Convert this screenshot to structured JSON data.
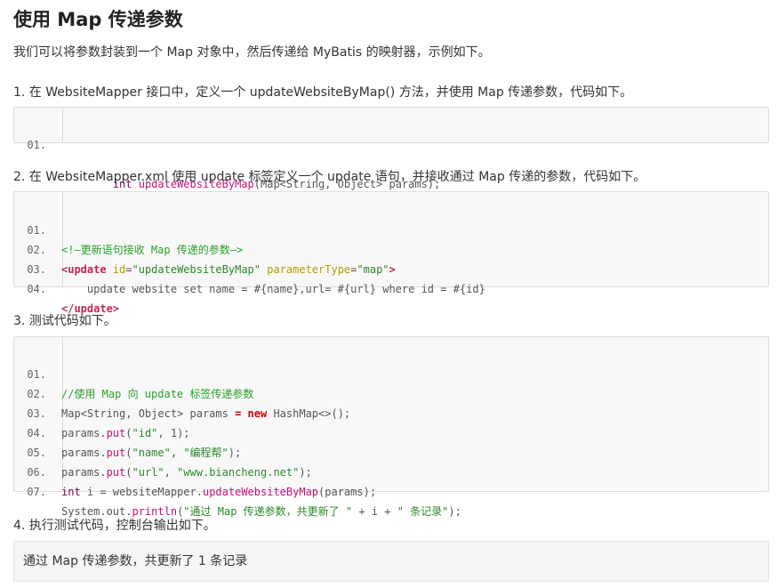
{
  "title": "使用 Map 传递参数",
  "intro": "我们可以将参数封装到一个 Map 对象中，然后传递给 MyBatis 的映射器，示例如下。",
  "steps": [
    {
      "text": "1. 在 WebsiteMapper 接口中，定义一个 updateWebsiteByMap() 方法，并使用 Map 传递参数，代码如下。"
    },
    {
      "text": "2. 在 WebsiteMapper.xml 使用 update 标签定义一个 update 语句，并接收通过 Map 传递的参数，代码如下。"
    },
    {
      "text": "3. 测试代码如下。"
    },
    {
      "text": "4. 执行测试代码，控制台输出如下。"
    }
  ],
  "code1": {
    "line_numbers": [
      "01."
    ],
    "lines": [
      [
        "int",
        " ",
        "updateWebsiteByMap",
        "(Map<String, Object> params);"
      ]
    ]
  },
  "code2": {
    "line_numbers": [
      "01.",
      "02.",
      "03.",
      "04."
    ],
    "l1": "<!—更新语句接收 Map 传递的参数—>",
    "l2_tag": "<update",
    "l2_sp1": " ",
    "l2_attr1": "id",
    "l2_eq1": "=",
    "l2_val1": "\"updateWebsiteByMap\"",
    "l2_sp2": " ",
    "l2_attr2": "parameterType",
    "l2_eq2": "=",
    "l2_val2": "\"map\"",
    "l2_close": ">",
    "l3": "    update website set name = #{name},url= #{url} where id = #{id}",
    "l4": "</update>"
  },
  "code3": {
    "line_numbers": [
      "01.",
      "02.",
      "03.",
      "04.",
      "05.",
      "06.",
      "07."
    ],
    "l1": "//使用 Map 向 update 标签传递参数",
    "l2a": "Map<String, Object> params ",
    "l2b": "=",
    "l2c": " ",
    "l2d": "new",
    "l2e": " HashMap<>();",
    "l3a": "params.",
    "l3b": "put",
    "l3c": "(",
    "l3d": "\"id\"",
    "l3e": ", 1);",
    "l4a": "params.",
    "l4b": "put",
    "l4c": "(",
    "l4d": "\"name\"",
    "l4e": ", ",
    "l4f": "\"编程帮\"",
    "l4g": ");",
    "l5a": "params.",
    "l5b": "put",
    "l5c": "(",
    "l5d": "\"url\"",
    "l5e": ", ",
    "l5f": "\"www.biancheng.net\"",
    "l5g": ");",
    "l6a": "int",
    "l6b": " i = websiteMapper.",
    "l6c": "updateWebsiteByMap",
    "l6d": "(params);",
    "l7a": "System.out.",
    "l7b": "println",
    "l7c": "(",
    "l7d": "\"通过 Map 传递参数，共更新了 \"",
    "l7e": " + i + ",
    "l7f": "\" 条记录\"",
    "l7g": ");"
  },
  "output": "通过 Map 传递参数，共更新了 1 条记录"
}
